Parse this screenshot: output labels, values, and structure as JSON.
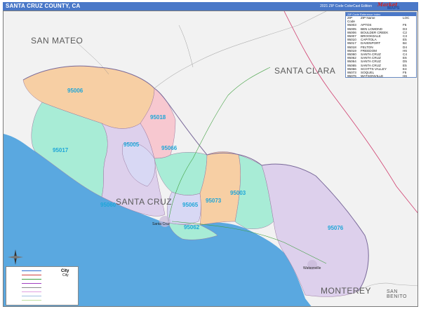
{
  "header": {
    "title": "SANTA CRUZ COUNTY, CA",
    "edition": "2021 ZIP Code ColorCast Edition",
    "brand_line1": "Market",
    "brand_line2": "MAPS"
  },
  "regions": {
    "san_mateo": "SAN MATEO",
    "santa_clara": "SANTA CLARA",
    "santa_cruz": "SANTA CRUZ",
    "monterey": "MONTEREY",
    "san_benito": "SAN BENITO"
  },
  "zip_labels": [
    "95006",
    "95018",
    "95005",
    "95066",
    "95017",
    "95003",
    "95060",
    "95065",
    "95073",
    "95062",
    "95076"
  ],
  "cities": {
    "santa_cruz": "Santa Cruz",
    "watsonville": "Watsonville"
  },
  "zip_table": {
    "caption": "ZIP Code Reference Index",
    "headers": [
      "ZIP Code",
      "ZIP Name",
      "LOC"
    ],
    "rows": [
      [
        "95003",
        "APTOS",
        "F5"
      ],
      [
        "95005",
        "BEN LOMOND",
        "D3"
      ],
      [
        "95006",
        "BOULDER CREEK",
        "C2"
      ],
      [
        "95007",
        "BROOKDALE",
        "C3"
      ],
      [
        "95010",
        "CAPITOLA",
        "E5"
      ],
      [
        "95017",
        "DAVENPORT",
        "B4"
      ],
      [
        "95018",
        "FELTON",
        "D4"
      ],
      [
        "95019",
        "FREEDOM",
        "H6"
      ],
      [
        "95060",
        "SANTA CRUZ",
        "C4"
      ],
      [
        "95062",
        "SANTA CRUZ",
        "E6"
      ],
      [
        "95064",
        "SANTA CRUZ",
        "D5"
      ],
      [
        "95065",
        "SANTA CRUZ",
        "E5"
      ],
      [
        "95066",
        "SCOTTS VALLEY",
        "E4"
      ],
      [
        "95073",
        "SOQUEL",
        "F5"
      ],
      [
        "95076",
        "WATSONVILLE",
        "H6"
      ]
    ]
  },
  "legend": {
    "city_label": "City",
    "city_label2": "City",
    "colors": {
      "interstate": "#2a6ad0",
      "us_highway": "#d04040",
      "state_highway": "#40a040",
      "county_highway": "#a040c0",
      "railroad": "#8a8a8a"
    }
  },
  "colors": {
    "ocean": "#5aa8e0",
    "land_outside": "#f2f2f2",
    "zip_orange": "#f7cfa4",
    "zip_purple": "#ddd0ec",
    "zip_teal": "#a8ecd6",
    "zip_pink": "#f7c8d0",
    "zip_lavender": "#d8d8f4",
    "title_bar": "#4a78c8",
    "zip_label": "#1ea6d8"
  }
}
